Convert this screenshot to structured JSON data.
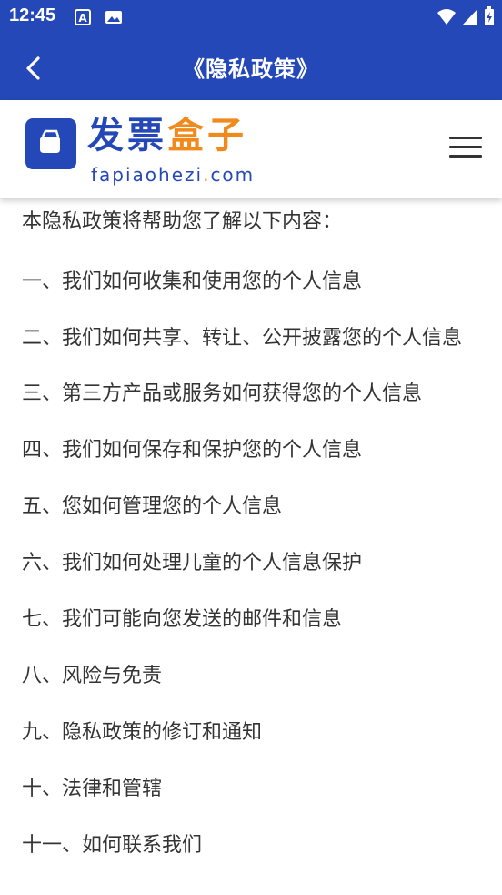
{
  "status_bar": {
    "time": "12:45"
  },
  "app_bar": {
    "title": "《隐私政策》"
  },
  "header": {
    "logo_main_blue": "发票",
    "logo_main_orange": "盒子",
    "logo_sub_1": "fapiaohezi",
    "logo_sub_dot": ".",
    "logo_sub_2": "com"
  },
  "content": {
    "intro": "本隐私政策将帮助您了解以下内容：",
    "items": [
      "一、我们如何收集和使用您的个人信息",
      "二、我们如何共享、转让、公开披露您的个人信息",
      "三、第三方产品或服务如何获得您的个人信息",
      "四、我们如何保存和保护您的个人信息",
      "五、您如何管理您的个人信息",
      "六、我们如何处理儿童的个人信息保护",
      "七、我们可能向您发送的邮件和信息",
      "八、风险与免责",
      "九、隐私政策的修订和通知",
      "十、法律和管辖",
      "十一、如何联系我们"
    ]
  },
  "colors": {
    "brand_blue": "#2448B8",
    "brand_orange": "#F08A1C"
  }
}
